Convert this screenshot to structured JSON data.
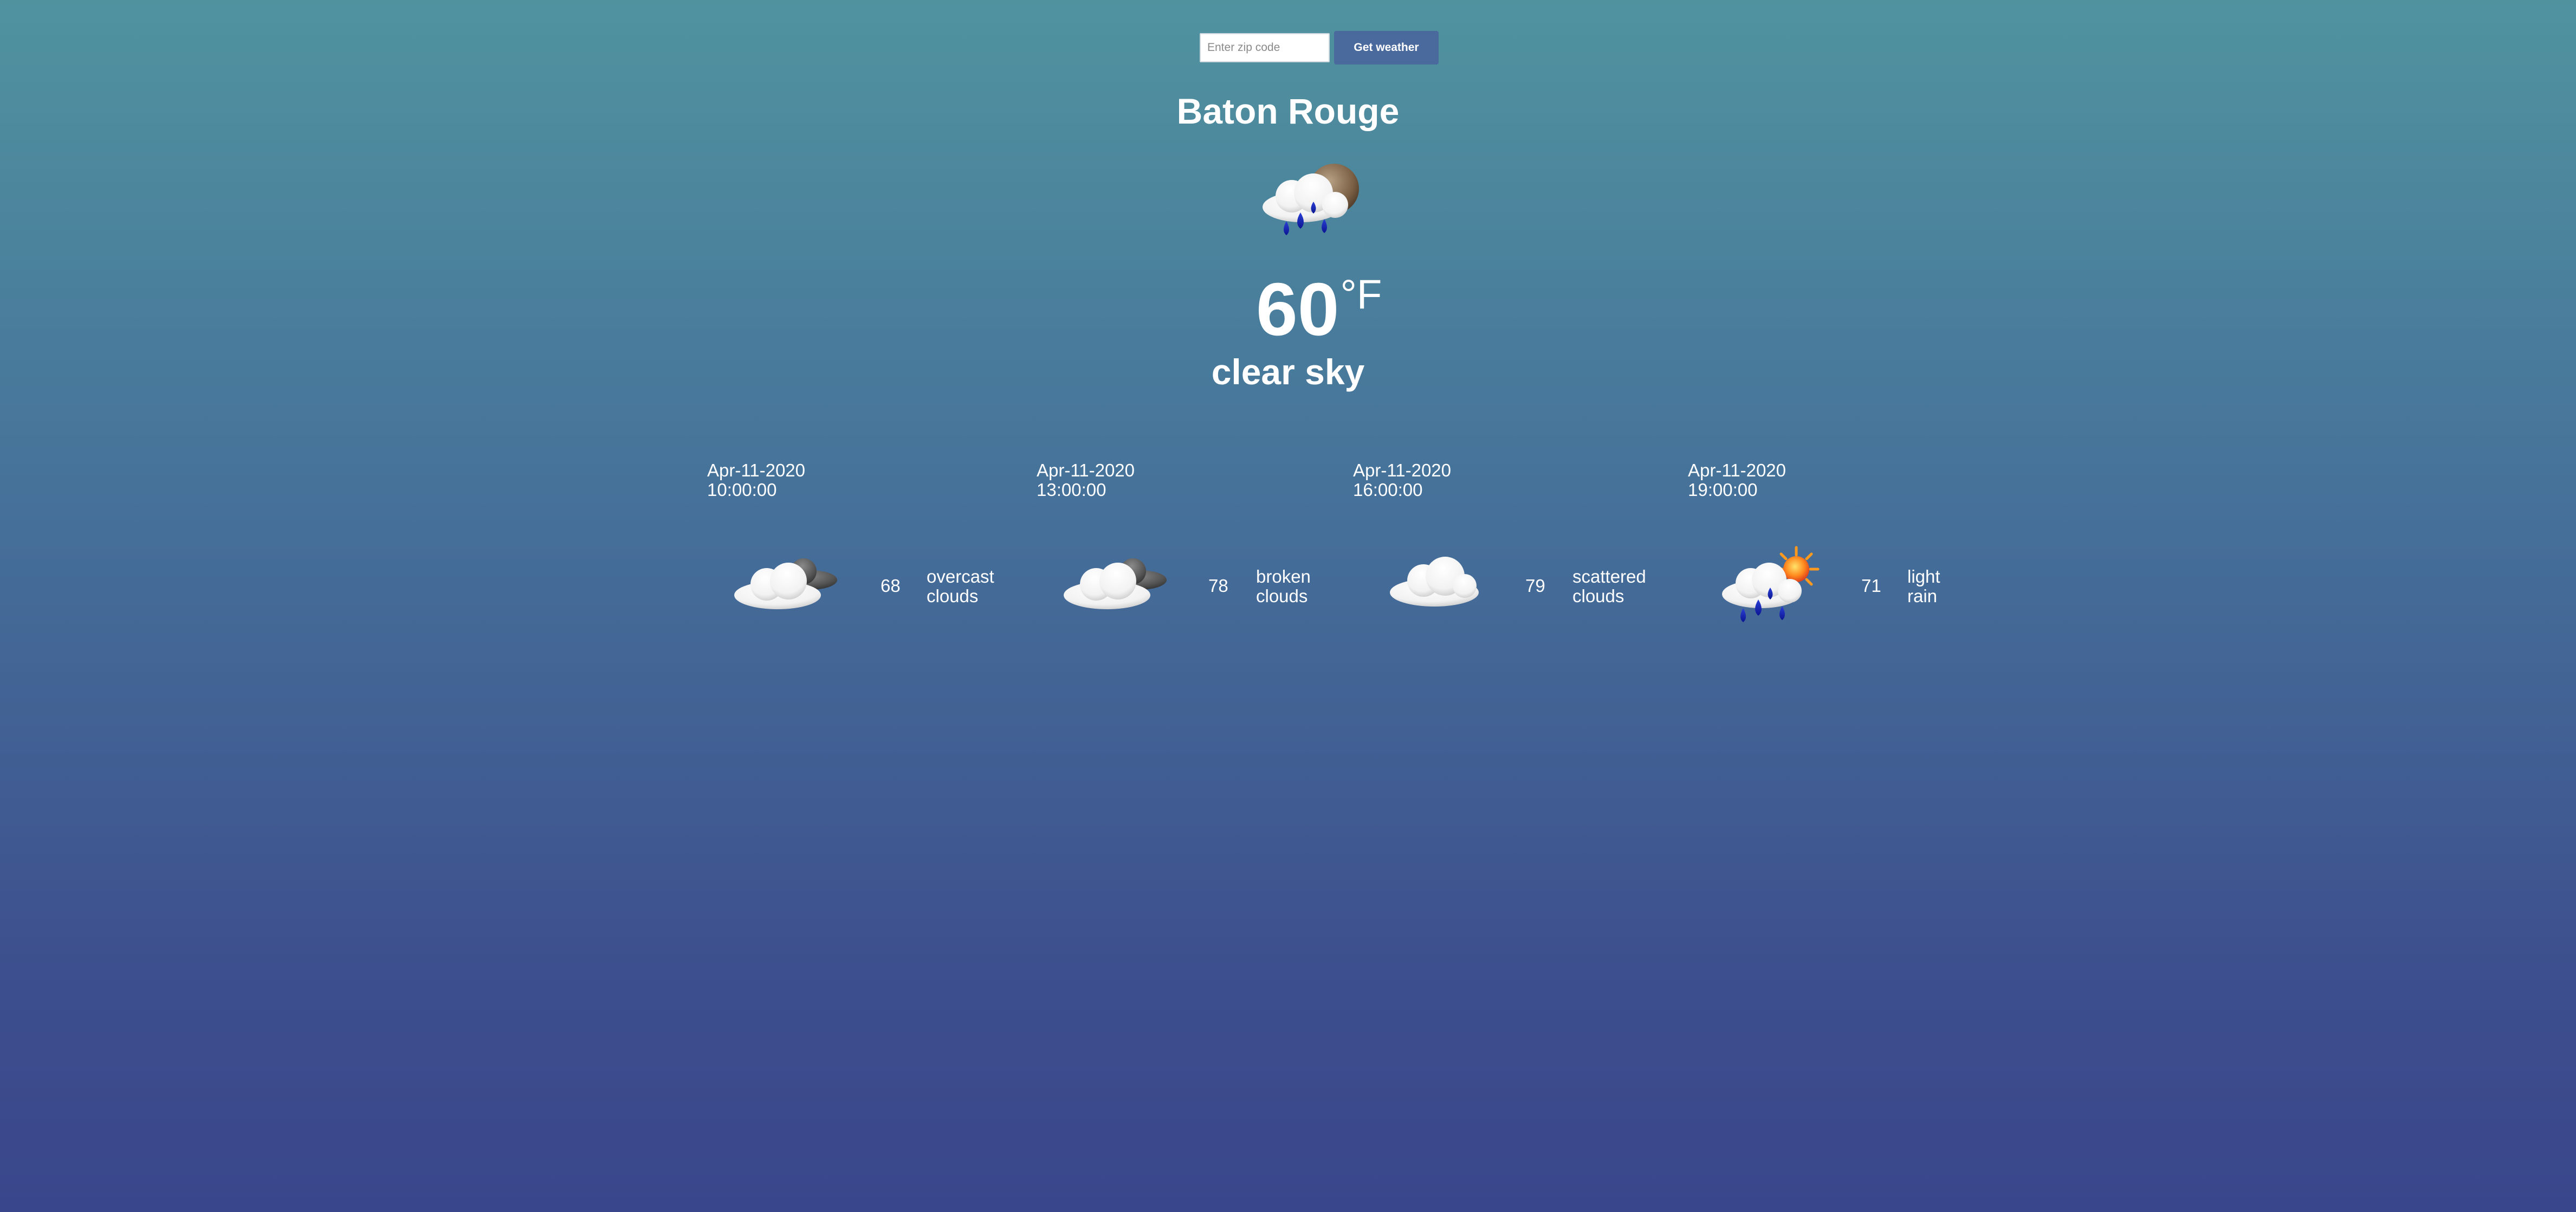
{
  "search": {
    "placeholder": "Enter zip code",
    "button_label": "Get weather"
  },
  "current": {
    "city": "Baton Rouge",
    "icon": "rain-night-cloud-icon",
    "temperature": "60",
    "unit": "°F",
    "description": "clear sky"
  },
  "forecast": [
    {
      "date": "Apr-11-2020",
      "time": "10:00:00",
      "temp": "68",
      "desc_line1": "overcast",
      "desc_line2": "clouds",
      "icon": "overcast-clouds-icon"
    },
    {
      "date": "Apr-11-2020",
      "time": "13:00:00",
      "temp": "78",
      "desc_line1": "broken",
      "desc_line2": "clouds",
      "icon": "broken-clouds-icon"
    },
    {
      "date": "Apr-11-2020",
      "time": "16:00:00",
      "temp": "79",
      "desc_line1": "scattered",
      "desc_line2": "clouds",
      "icon": "scattered-clouds-icon"
    },
    {
      "date": "Apr-11-2020",
      "time": "19:00:00",
      "temp": "71",
      "desc_line1": "light",
      "desc_line2": "rain",
      "icon": "light-rain-icon"
    }
  ],
  "colors": {
    "background_top": "#50939f",
    "background_bottom": "#3a468b",
    "button": "#4a6a9d",
    "text": "#ffffff"
  }
}
